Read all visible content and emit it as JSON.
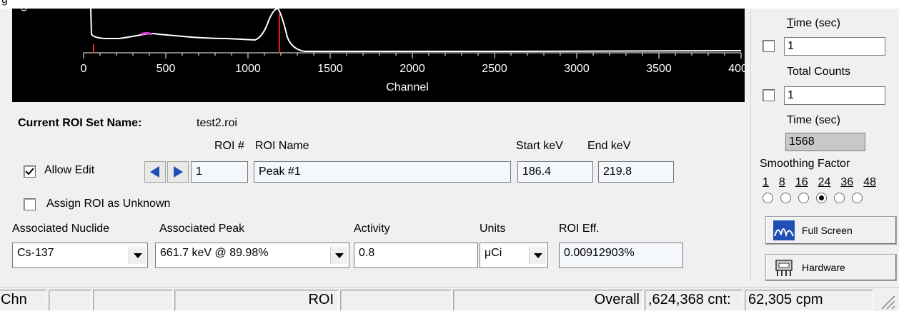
{
  "top_strip": {
    "glyph": "g"
  },
  "spectrum": {
    "y_label": "co",
    "x_axis_title": "Channel",
    "x_ticks": [
      "0",
      "500",
      "1000",
      "1500",
      "2000",
      "2500",
      "3000",
      "3500",
      "4000"
    ],
    "colors": {
      "background": "#000000",
      "trace": "#ffffff",
      "roi_marker": "#e02020",
      "highlight": "#e040e0"
    }
  },
  "right_panel": {
    "time_label": "Time (sec)",
    "time_value": "1",
    "total_counts_label": "Total Counts",
    "total_counts_value": "1",
    "elapsed_time_label": "Time (sec)",
    "elapsed_time_value": "1568",
    "smoothing_label": "Smoothing Factor",
    "smoothing_options": [
      "1",
      "8",
      "16",
      "24",
      "36",
      "48"
    ],
    "smoothing_selected": "24",
    "full_screen_label": "Full Screen",
    "hardware_label": "Hardware"
  },
  "roi": {
    "set_name_label": "Current ROI Set Name:",
    "set_name_value": "test2.roi",
    "roi_num_label": "ROI #",
    "roi_name_label": "ROI Name",
    "start_kev_label": "Start keV",
    "end_kev_label": "End keV",
    "allow_edit_label": "Allow Edit",
    "allow_edit_checked": true,
    "roi_num_value": "1",
    "roi_name_value": "Peak #1",
    "start_kev_value": "186.4",
    "end_kev_value": "219.8",
    "assign_unknown_label": "Assign ROI as Unknown",
    "assoc_nuclide_label": "Associated Nuclide",
    "assoc_peak_label": "Associated Peak",
    "activity_label": "Activity",
    "units_label": "Units",
    "roi_eff_label": "ROI Eff.",
    "nuclide_value": "Cs-137",
    "peak_value": "661.7 keV @ 89.98%",
    "activity_value": "0.8",
    "units_value": "μCi",
    "roi_eff_value": "0.00912903%"
  },
  "status_bar": {
    "chn_label": "Chn",
    "roi_label": "ROI",
    "overall_label": "Overall",
    "counts_value": ",624,368 cnt:",
    "cpm_value": "62,305 cpm"
  }
}
